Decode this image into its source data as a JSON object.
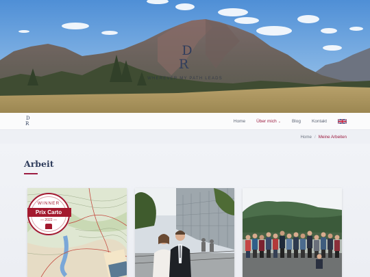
{
  "hero": {
    "logo_line1": "D",
    "logo_line2": "R",
    "tagline": "WHEREVER MY PATH LEADS"
  },
  "navbar": {
    "logo_line1": "D",
    "logo_line2": "R",
    "items": [
      {
        "label": "Home",
        "active": false
      },
      {
        "label": "Über mich",
        "active": true,
        "has_dropdown": true
      },
      {
        "label": "Blog",
        "active": false
      },
      {
        "label": "Kontakt",
        "active": false
      }
    ],
    "language_icon": "uk-flag-icon"
  },
  "breadcrumb": {
    "home": "Home",
    "separator": "/",
    "current": "Meine Arbeiten"
  },
  "section": {
    "title": "Arbeit"
  },
  "cards": [
    {
      "image": "map-with-award-badge",
      "badge": {
        "top": "WINNER",
        "band": "Prix Carto",
        "year": "— 2022 —"
      }
    },
    {
      "image": "couple-photo-modern-building"
    },
    {
      "image": "group-photo-mountains"
    }
  ],
  "colors": {
    "accent": "#9b1b3f",
    "heading": "#2f3d5c",
    "badge_red": "#a3192e"
  }
}
